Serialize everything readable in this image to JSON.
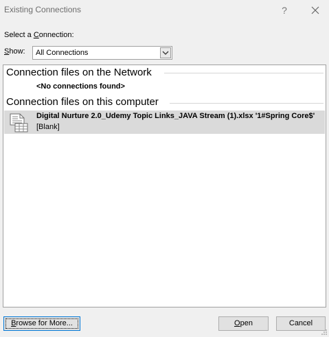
{
  "window": {
    "title": "Existing Connections",
    "help_label": "?",
    "icons": {
      "close": "close-icon"
    }
  },
  "select_label": {
    "before": "Select a ",
    "accel": "C",
    "after": "onnection:"
  },
  "show_label": {
    "accel": "S",
    "after": "how:"
  },
  "show_filter": {
    "selected": "All Connections",
    "icon": "chevron-down-icon"
  },
  "groups": {
    "network": {
      "header": "Connection files on the Network",
      "empty_text": "<No connections found>"
    },
    "computer": {
      "header": "Connection files on this computer",
      "items": [
        {
          "name": "Digital Nurture 2.0_Udemy Topic Links_JAVA Stream (1).xlsx '1#Spring Core$'",
          "description": "[Blank]",
          "icon": "spreadsheet-file-icon",
          "selected": true
        }
      ]
    }
  },
  "buttons": {
    "browse": {
      "before": "",
      "accel": "B",
      "after": "rowse for More..."
    },
    "open": {
      "before": "",
      "accel": "O",
      "after": "pen"
    },
    "cancel": {
      "label": "Cancel"
    }
  },
  "colors": {
    "background": "#f0f0f0",
    "selection": "#dadada",
    "focus_border": "#0078d7"
  }
}
